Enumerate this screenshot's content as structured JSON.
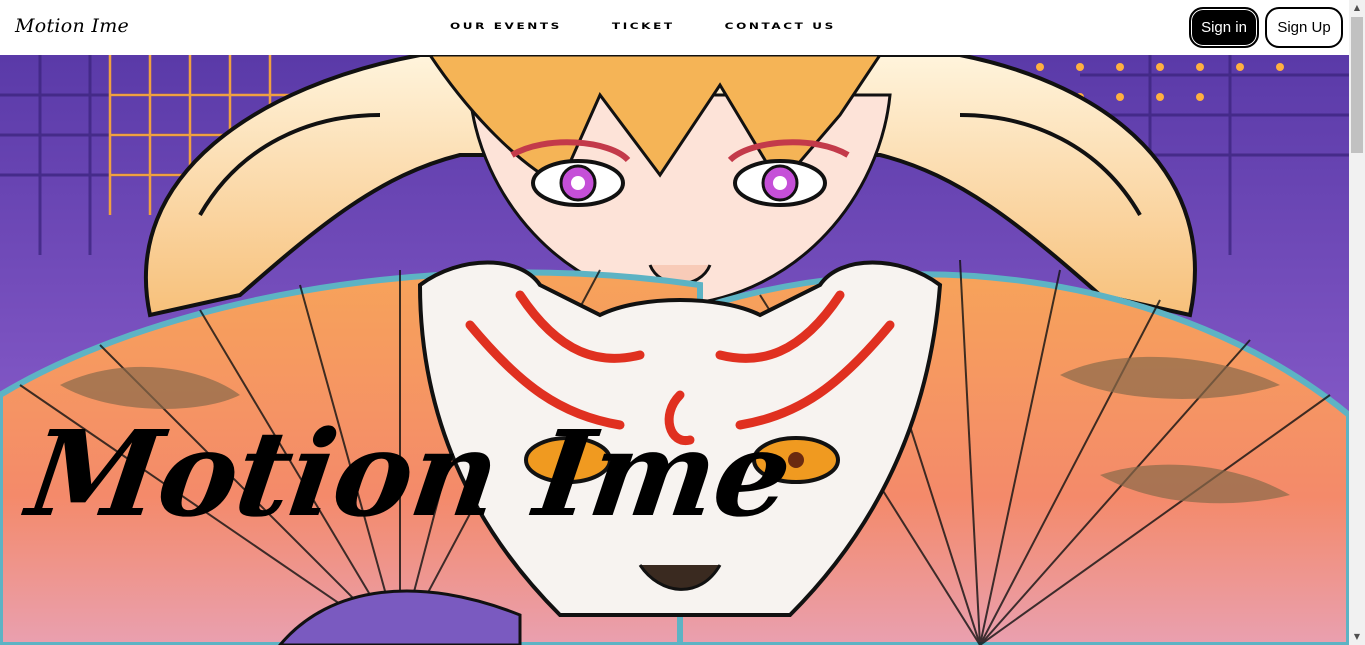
{
  "nav": {
    "brand": "Motion Ime",
    "links": [
      "OUR EVENTS",
      "TICKET",
      "CONTACT US"
    ],
    "signin_label": "Sign in",
    "signup_label": "Sign Up"
  },
  "hero": {
    "title": "Motion Ime"
  },
  "colors": {
    "accent_black": "#000000",
    "hero_bg": "#f4a070",
    "purple_bg": "#7a4fc4"
  },
  "icons": {
    "scroll_up": "triangle-up-icon",
    "scroll_down": "triangle-down-icon"
  }
}
